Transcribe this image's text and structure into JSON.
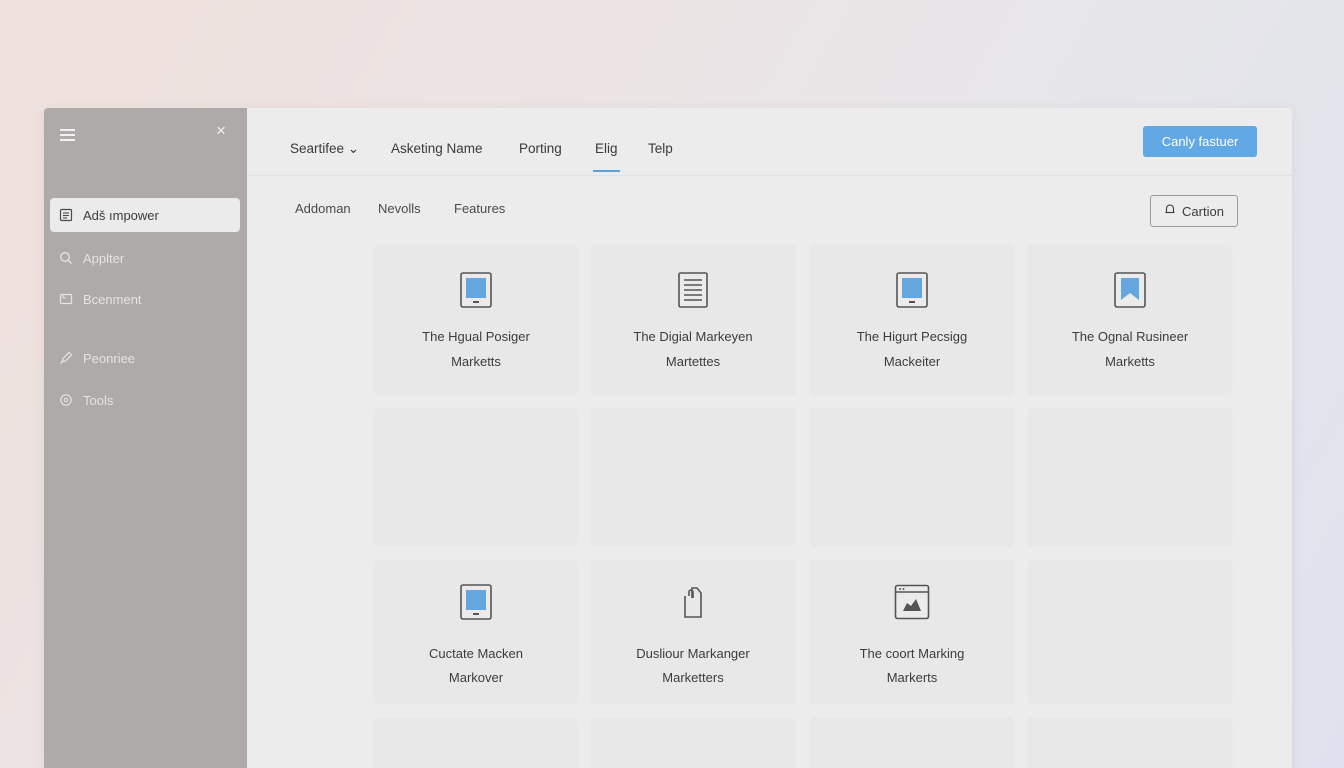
{
  "sidebar": {
    "items": [
      {
        "label": "Adš ımpower",
        "icon": "document-icon",
        "active": true
      },
      {
        "label": "Applter",
        "icon": "search-icon",
        "active": false
      },
      {
        "label": "Bcenment",
        "icon": "folder-icon",
        "active": false
      },
      {
        "label": "Peonriee",
        "icon": "pen-icon",
        "active": false
      },
      {
        "label": "Tools",
        "icon": "settings-icon",
        "active": false
      }
    ]
  },
  "nav": {
    "items": [
      {
        "label": "Seartifee ⌄"
      },
      {
        "label": "Asketing Name"
      },
      {
        "label": "Porting"
      },
      {
        "label": "Elig"
      },
      {
        "label": "Telp"
      }
    ],
    "active_index": 3,
    "primary_button": "Canly fastuer"
  },
  "subtabs": [
    "Addoman",
    "Nevolls",
    "Features"
  ],
  "caption_button": "Cartion",
  "accent_color": "#62a8e5",
  "cards": [
    {
      "title": "The Hgual Posiger",
      "subtitle": "Marketts",
      "icon": "tablet-icon"
    },
    {
      "title": "The Digial Markeyen",
      "subtitle": "Martettes",
      "icon": "document-lines-icon"
    },
    {
      "title": "The Higurt Pecsigg",
      "subtitle": "Mackeiter",
      "icon": "tablet-icon"
    },
    {
      "title": "The Ognal Rusineer",
      "subtitle": "Marketts",
      "icon": "bookmark-icon"
    },
    {
      "title": "",
      "subtitle": "",
      "icon": ""
    },
    {
      "title": "",
      "subtitle": "",
      "icon": ""
    },
    {
      "title": "",
      "subtitle": "",
      "icon": ""
    },
    {
      "title": "",
      "subtitle": "",
      "icon": ""
    },
    {
      "title": "Cuctate Macken",
      "subtitle": "Markover",
      "icon": "tablet-icon"
    },
    {
      "title": "Dusliour Markanger",
      "subtitle": "Marketters",
      "icon": "clipboard-icon"
    },
    {
      "title": "The coort Marking",
      "subtitle": "Markerts",
      "icon": "browser-image-icon"
    },
    {
      "title": "",
      "subtitle": "",
      "icon": ""
    },
    {
      "title": "",
      "subtitle": "",
      "icon": ""
    },
    {
      "title": "",
      "subtitle": "",
      "icon": ""
    },
    {
      "title": "",
      "subtitle": "",
      "icon": ""
    },
    {
      "title": "",
      "subtitle": "",
      "icon": ""
    }
  ]
}
